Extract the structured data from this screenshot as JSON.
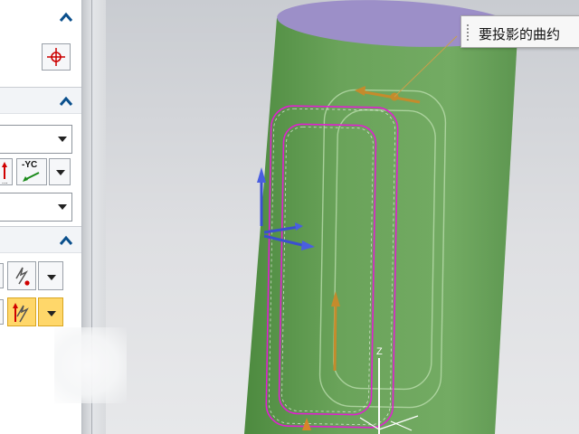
{
  "panel": {
    "x_vector_button": {
      "label": "-YC",
      "icon": "direction-arrow-icon"
    },
    "color_marker": "#e00000",
    "highlight_color": "#ffd76a"
  },
  "viewport": {
    "tooltip_text": "要投影的曲约",
    "axis_label": "Z",
    "cylinder": {
      "body_color": "#6aa35a",
      "cap_color": "#9c8fc8"
    },
    "curve_color": "#e020d0"
  }
}
